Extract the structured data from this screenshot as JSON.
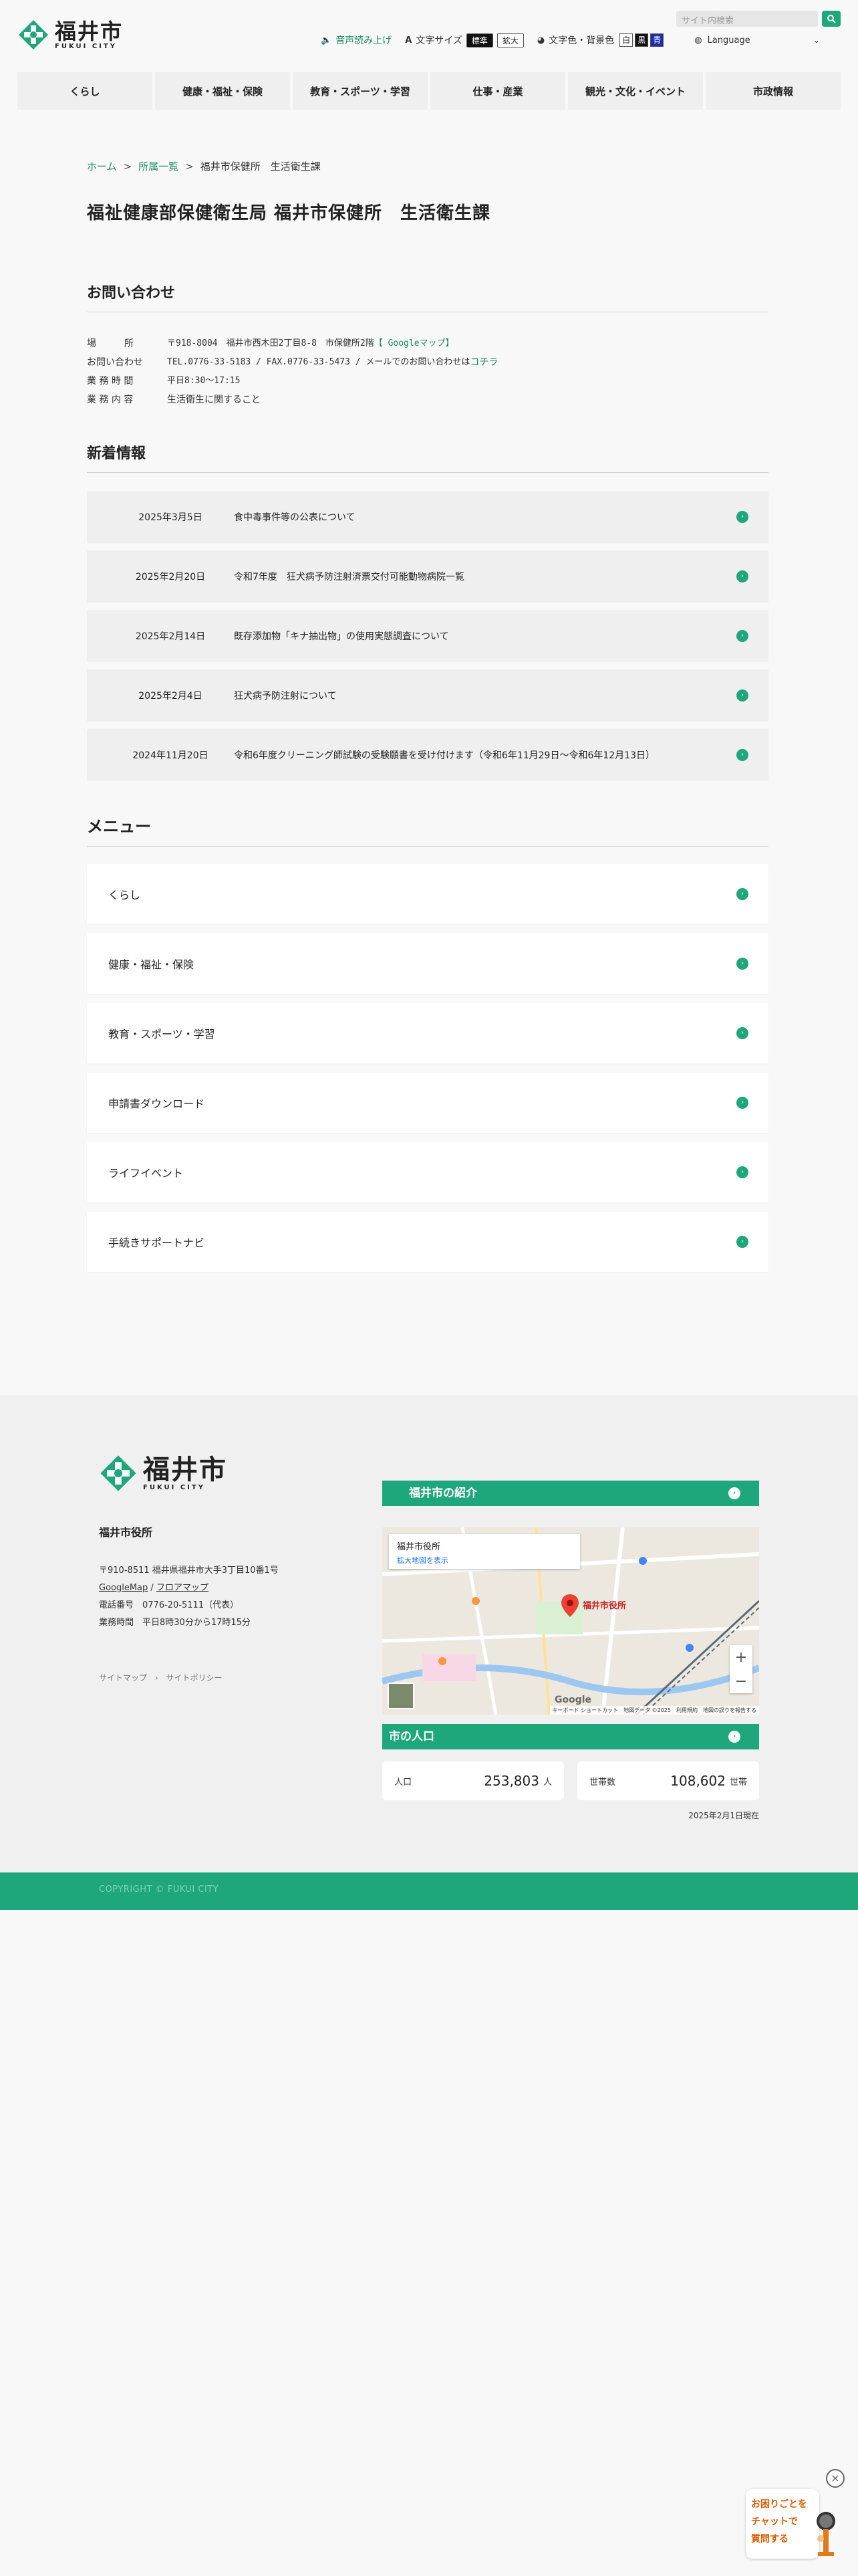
{
  "header": {
    "logo_jp": "福井市",
    "logo_en": "FUKUI CITY",
    "search_placeholder": "サイト内検索",
    "voice_label": "音声読み上げ",
    "font_size_label": "文字サイズ",
    "font_standard": "標準",
    "font_large": "拡大",
    "color_label": "文字色・背景色",
    "color_white": "白",
    "color_black": "黒",
    "color_blue": "青",
    "language_label": "Language"
  },
  "nav": {
    "items": [
      {
        "label": "くらし"
      },
      {
        "label": "健康・福祉・保険"
      },
      {
        "label": "教育・スポーツ・学習"
      },
      {
        "label": "仕事・産業"
      },
      {
        "label": "観光・文化・イベント"
      },
      {
        "label": "市政情報"
      }
    ]
  },
  "breadcrumb": {
    "home": "ホーム",
    "list": "所属一覧",
    "current": "福井市保健所　生活衛生課"
  },
  "page_title": "福祉健康部保健衛生局 福井市保健所　生活衛生課",
  "contact": {
    "heading": "お問い合わせ",
    "place_label": "場　　　所",
    "place_value": "〒918-8004　福井市西木田2丁目8-8　市保健所2階",
    "map_link": "【 Googleマップ】",
    "inquiry_label": "お問い合わせ",
    "inquiry_value": "TEL.0776-33-5183 / FAX.0776-33-5473 / メールでのお問い合わせは",
    "mail_link": "コチラ",
    "hours_label": "業 務 時 間",
    "hours_value": "平日8:30～17:15",
    "work_label": "業 務 内 容",
    "work_value": "生活衛生に関すること"
  },
  "news": {
    "heading": "新着情報",
    "items": [
      {
        "date": "2025年3月5日",
        "title": "食中毒事件等の公表について"
      },
      {
        "date": "2025年2月20日",
        "title": "令和7年度　狂犬病予防注射済票交付可能動物病院一覧"
      },
      {
        "date": "2025年2月14日",
        "title": "既存添加物「キナ抽出物」の使用実態調査について"
      },
      {
        "date": "2025年2月4日",
        "title": "狂犬病予防注射について"
      },
      {
        "date": "2024年11月20日",
        "title": "令和6年度クリーニング師試験の受験願書を受け付けます（令和6年11月29日～令和6年12月13日）"
      }
    ]
  },
  "menu": {
    "heading": "メニュー",
    "items": [
      {
        "label": "くらし"
      },
      {
        "label": "健康・福祉・保険"
      },
      {
        "label": "教育・スポーツ・学習"
      },
      {
        "label": "申請書ダウンロード"
      },
      {
        "label": "ライフイベント"
      },
      {
        "label": "手続きサポートナビ"
      }
    ]
  },
  "footer": {
    "logo_jp": "福井市",
    "logo_en": "FUKUI CITY",
    "office": "福井市役所",
    "address": "〒910-8511 福井県福井市大手3丁目10番1号",
    "googlemap": "GoogleMap",
    "floormap": "フロアマップ",
    "slash": "/",
    "tel": "電話番号　0776-20-5111（代表）",
    "hours": "業務時間　平日8時30分から17時15分",
    "sitemap": "サイトマップ",
    "policy": "サイトポリシー",
    "intro_label": "福井市の紹介",
    "map_card_title": "福井市役所",
    "map_card_link": "拡大地図を表示",
    "map_pin_label": "福井市役所",
    "map_google": "Google",
    "map_attr": "キーボード ショートカット　地図データ ©2025　利用規約　地図の誤りを報告する",
    "population_label": "市の人口",
    "population_key": "人口",
    "population_value": "253,803",
    "population_unit": "人",
    "households_key": "世帯数",
    "households_value": "108,602",
    "households_unit": "世帯",
    "as_of": "2025年2月1日現在",
    "copyright": "COPYRIGHT © FUKUI CITY"
  },
  "chat": {
    "close": "×",
    "line1": "お困りごとを",
    "line2": "チャットで",
    "line3": "質問する"
  },
  "colors": {
    "accent": "#1ea77a",
    "link": "#1a8a64"
  }
}
